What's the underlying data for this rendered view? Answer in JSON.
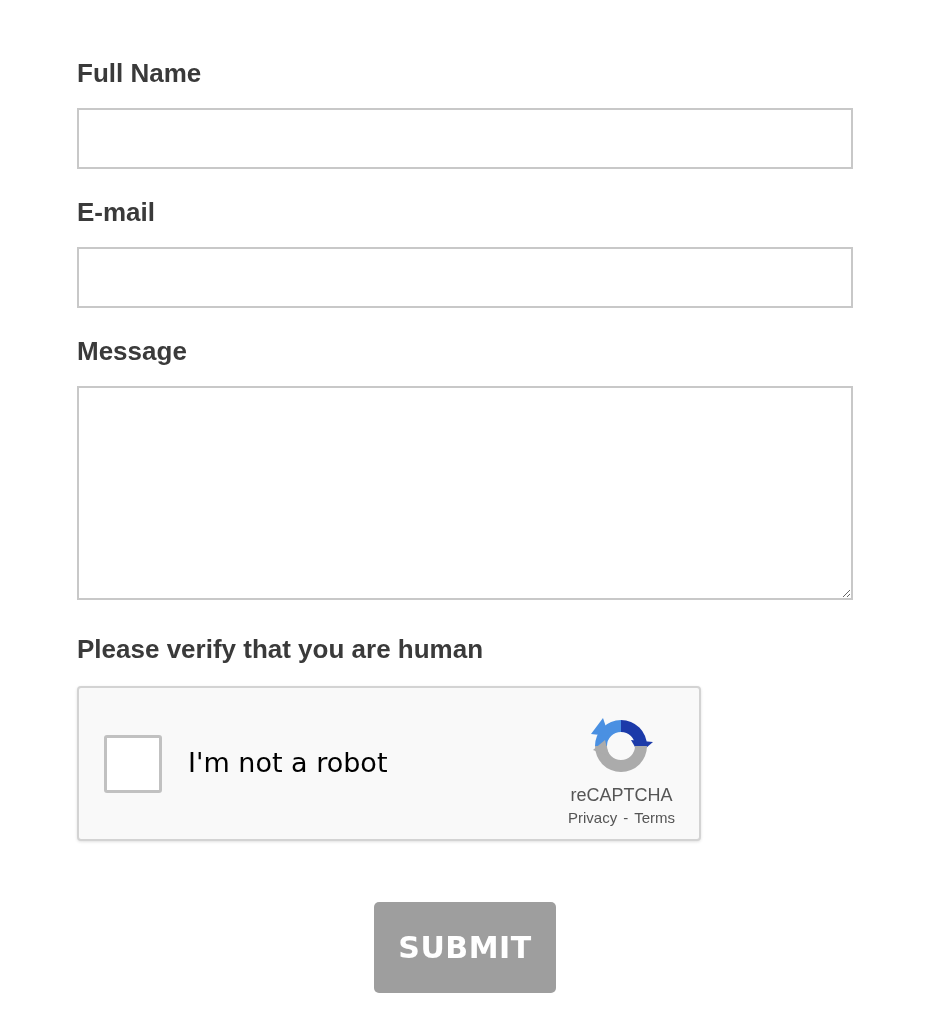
{
  "fields": [
    {
      "label": "Full Name",
      "kind": "input"
    },
    {
      "label": "E-mail",
      "kind": "input"
    },
    {
      "label": "Message",
      "kind": "textarea"
    }
  ],
  "captcha": {
    "heading": "Please verify that you are human",
    "checkbox_label": "I'm not a robot",
    "checked": false,
    "brand": "reCAPTCHA",
    "privacy_link": "Privacy",
    "separator": "-",
    "terms_link": "Terms"
  },
  "submit": {
    "label": "SUBMIT"
  }
}
